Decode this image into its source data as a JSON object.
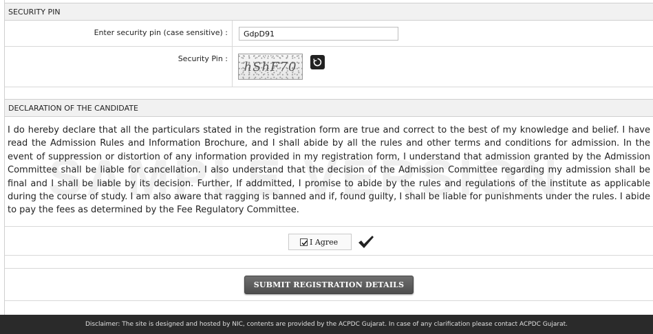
{
  "security_section": {
    "title": "SECURITY PIN",
    "enter_pin_label": "Enter security pin (case sensitive) :",
    "enter_pin_value": "GdpD91",
    "security_pin_label": "Security Pin :",
    "captcha_text": "hShF70",
    "refresh_icon": "refresh-icon"
  },
  "declaration_section": {
    "title": "DECLARATION OF THE CANDIDATE",
    "text": "I do hereby declare that all the particulars stated in the registration form are true and correct to the best of my knowledge and belief. I have read the Admission Rules and Information Brochure, and I shall abide by all the rules and other terms and conditions for admission. In the event of suppression or distortion of any information provided in my registration form, I understand that admission granted by the Admission Committee shall be liable for cancellation. I also understand that the decision of the Admission Committee regarding my admission shall be final and I shall be liable by its decision. Further, If addmitted, I promise to abide by the rules and regulations of the institute as applicable during the course of study. I am also aware that ragging is banned and if, found guilty, I shall be liable for punishments under the rules. I abide to pay the fees as determined by the Fee Regulatory Committee.",
    "agree_label": "I Agree",
    "agree_checked": true
  },
  "submit": {
    "label": "SUBMIT REGISTRATION DETAILS"
  },
  "footer": {
    "disclaimer": "Disclaimer: The site is designed and hosted by NIC, contents are provided by the ACPDC Gujarat. In case of any clarification please contact ACPDC Gujarat."
  }
}
